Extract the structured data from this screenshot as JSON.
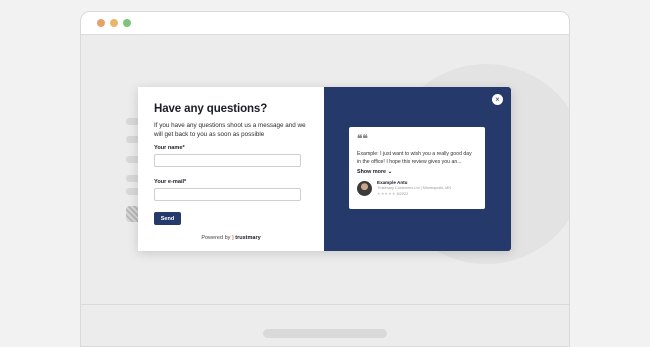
{
  "browser": {
    "dots": [
      "close",
      "minimize",
      "maximize"
    ]
  },
  "form": {
    "title": "Have any questions?",
    "description": "If you have any questions shoot us a message and we will get back to you as soon as possible",
    "name_label": "Your name*",
    "name_value": "",
    "email_label": "Your e-mail*",
    "email_value": "",
    "send_label": "Send",
    "powered_by": "Powered by",
    "brand_mark": "]",
    "brand_name": "trustmary"
  },
  "review": {
    "close_glyph": "×",
    "quote_glyph": "❝❝",
    "text": "Example: I just want to wish you a really good day in the office! I hope this review gives you an...",
    "show_more": "Show more",
    "show_more_glyph": "⌄",
    "author_name": "Example Antu",
    "author_company": "Trustmary Customers Ltd | Minneapolis, MN",
    "stars": "★★★★★",
    "date": "8/2022"
  },
  "colors": {
    "modal_dark": "#253a6b",
    "brand": "#e8873d"
  }
}
